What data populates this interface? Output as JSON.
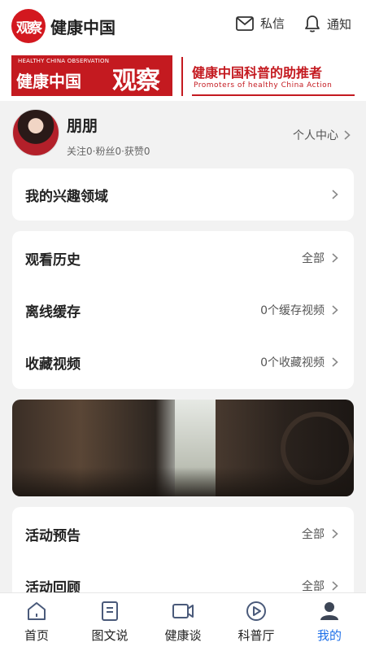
{
  "header": {
    "logo_text": "观察",
    "title": "健康中国",
    "messages_label": "私信",
    "notifications_label": "通知"
  },
  "banner": {
    "tagline": "HEALTHY CHINA OBSERVATION",
    "name": "健康中国",
    "word": "观察",
    "slogan": "健康中国科普的助推者",
    "slogan_en": "Promoters of healthy China Action"
  },
  "profile": {
    "name": "朋朋",
    "stats": "关注0·粉丝0·获赞0",
    "center_label": "个人中心"
  },
  "interest": {
    "label": "我的兴趣领域"
  },
  "history_card": {
    "rows": [
      {
        "label": "观看历史",
        "value": "全部"
      },
      {
        "label": "离线缓存",
        "value": "0个缓存视频"
      },
      {
        "label": "收藏视频",
        "value": "0个收藏视频"
      }
    ]
  },
  "activity_card": {
    "rows": [
      {
        "label": "活动预告",
        "value": "全部"
      },
      {
        "label": "活动回顾",
        "value": "全部"
      }
    ]
  },
  "nav": {
    "items": [
      {
        "label": "首页",
        "icon": "home-icon"
      },
      {
        "label": "图文说",
        "icon": "document-icon"
      },
      {
        "label": "健康谈",
        "icon": "video-camera-icon"
      },
      {
        "label": "科普厅",
        "icon": "play-circle-icon"
      },
      {
        "label": "我的",
        "icon": "user-icon"
      }
    ],
    "active_index": 4,
    "active_color": "#1f70e8"
  },
  "colors": {
    "brand_red": "#c41a20",
    "accent_blue": "#1f70e8"
  }
}
